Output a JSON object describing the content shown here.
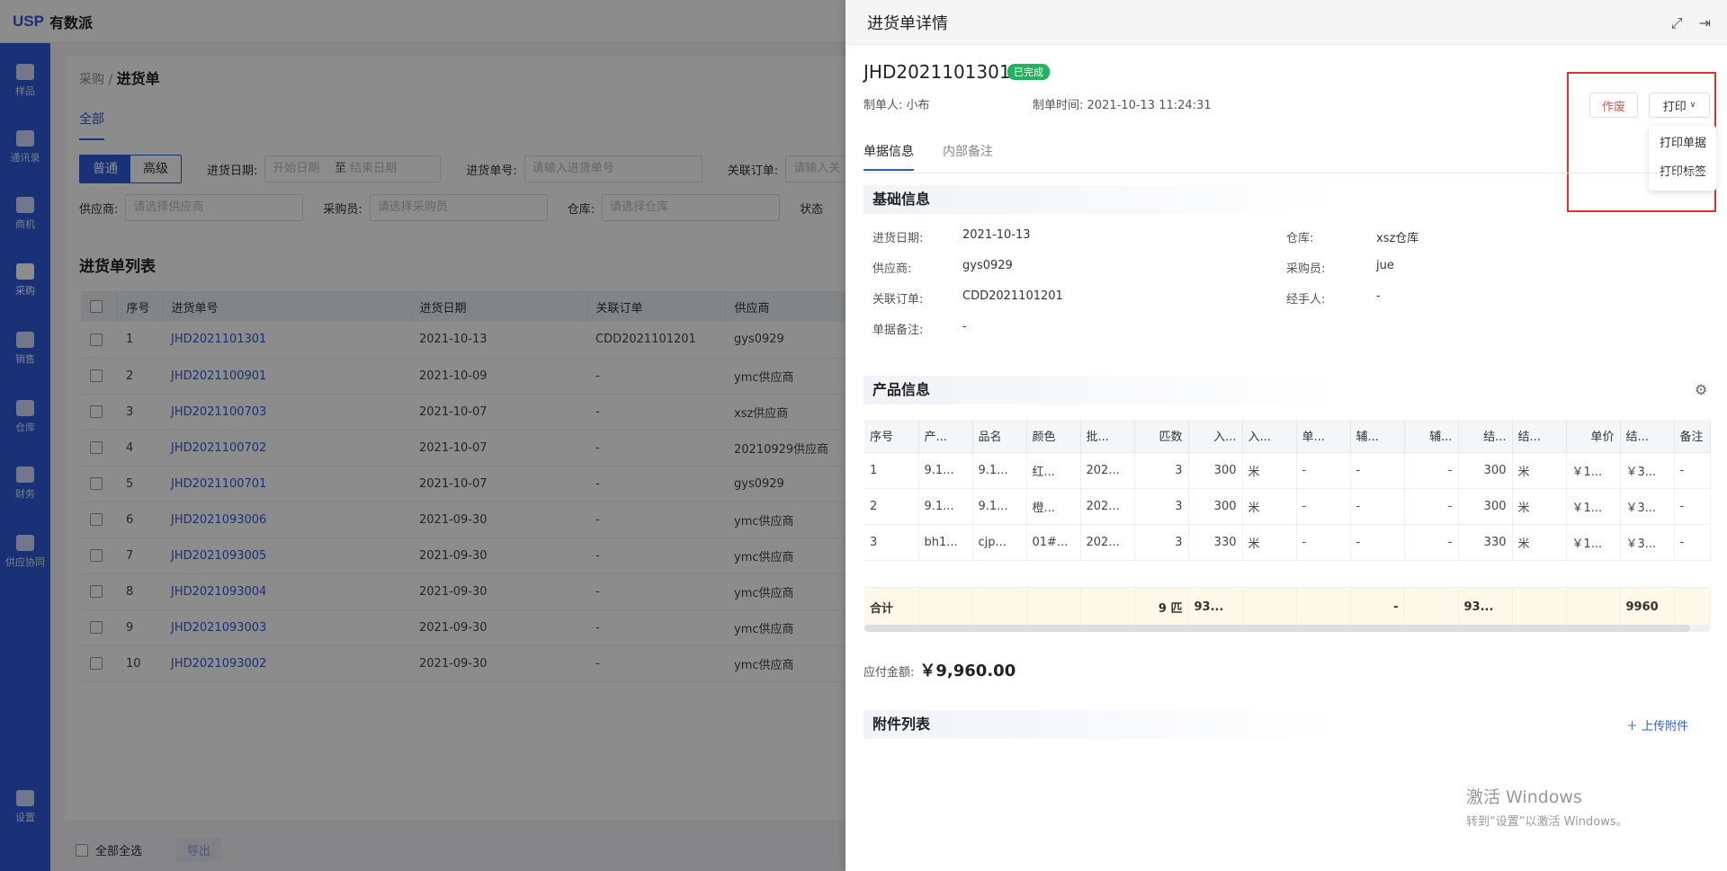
{
  "app": {
    "logo_mark": "USP",
    "logo_text": "有数派"
  },
  "sidebar": {
    "items": [
      {
        "label": "样品"
      },
      {
        "label": "通讯录"
      },
      {
        "label": "商机"
      },
      {
        "label": "采购",
        "active": true
      },
      {
        "label": "销售"
      },
      {
        "label": "仓库"
      },
      {
        "label": "财务"
      },
      {
        "label": "供应协同"
      },
      {
        "label": "设置"
      }
    ]
  },
  "page": {
    "breadcrumb_parent": "采购",
    "breadcrumb_sep": "/",
    "breadcrumb_current": "进货单",
    "tab_all": "全部",
    "filter": {
      "mode_normal": "普通",
      "mode_advanced": "高级",
      "date_label": "进货日期:",
      "date_start": "开始日期",
      "date_to": "至",
      "date_end": "结束日期",
      "no_label": "进货单号:",
      "no_placeholder": "请输入进货单号",
      "order_label": "关联订单:",
      "order_placeholder": "请输入关",
      "supplier_label": "供应商:",
      "supplier_placeholder": "请选择供应商",
      "buyer_label": "采购员:",
      "buyer_placeholder": "请选择采购员",
      "warehouse_label": "仓库:",
      "warehouse_placeholder": "请选择仓库",
      "status_label": "状态"
    },
    "list_title": "进货单列表",
    "columns": [
      "序号",
      "进货单号",
      "进货日期",
      "关联订单",
      "供应商"
    ],
    "rows": [
      [
        "1",
        "JHD2021101301",
        "2021-10-13",
        "CDD2021101201",
        "gys0929"
      ],
      [
        "2",
        "JHD2021100901",
        "2021-10-09",
        "-",
        "ymc供应商"
      ],
      [
        "3",
        "JHD2021100703",
        "2021-10-07",
        "-",
        "xsz供应商"
      ],
      [
        "4",
        "JHD2021100702",
        "2021-10-07",
        "-",
        "20210929供应商"
      ],
      [
        "5",
        "JHD2021100701",
        "2021-10-07",
        "-",
        "gys0929"
      ],
      [
        "6",
        "JHD2021093006",
        "2021-09-30",
        "-",
        "ymc供应商"
      ],
      [
        "7",
        "JHD2021093005",
        "2021-09-30",
        "-",
        "ymc供应商"
      ],
      [
        "8",
        "JHD2021093004",
        "2021-09-30",
        "-",
        "ymc供应商"
      ],
      [
        "9",
        "JHD2021093003",
        "2021-09-30",
        "-",
        "ymc供应商"
      ],
      [
        "10",
        "JHD2021093002",
        "2021-09-30",
        "-",
        "ymc供应商"
      ]
    ],
    "select_all": "全部全选",
    "export": "导出"
  },
  "drawer": {
    "title": "进货单详情",
    "doc_no": "JHD2021101301",
    "status": "已完成",
    "creator_label": "制单人:",
    "creator": "小布",
    "time_label": "制单时间:",
    "time": "2021-10-13 11:24:31",
    "void_label": "作废",
    "print_label": "打印",
    "print_menu": [
      "打印单据",
      "打印标签"
    ],
    "tabs": [
      "单据信息",
      "内部备注"
    ],
    "basic_title": "基础信息",
    "basic": [
      {
        "label": "进货日期:",
        "value": "2021-10-13"
      },
      {
        "label": "供应商:",
        "value": "gys0929"
      },
      {
        "label": "关联订单:",
        "value": "CDD2021101201"
      },
      {
        "label": "单据备注:",
        "value": "-"
      },
      {
        "label": "仓库:",
        "value": "xsz仓库"
      },
      {
        "label": "采购员:",
        "value": "jue"
      },
      {
        "label": "经手人:",
        "value": "-"
      }
    ],
    "product_title": "产品信息",
    "product_columns": [
      "序号",
      "产...",
      "品名",
      "颜色",
      "批...",
      "匹数",
      "入...",
      "入...",
      "单...",
      "辅...",
      "辅...",
      "结...",
      "结...",
      "单价",
      "结...",
      "备注"
    ],
    "product_rows": [
      [
        "1",
        "9.1...",
        "9.1...",
        "红...",
        "202...",
        "3",
        "300",
        "米",
        "-",
        "-",
        "-",
        "300",
        "米",
        "￥1...",
        "￥3...",
        "-"
      ],
      [
        "2",
        "9.1...",
        "9.1...",
        "橙...",
        "202...",
        "3",
        "300",
        "米",
        "-",
        "-",
        "-",
        "300",
        "米",
        "￥1...",
        "￥3...",
        "-"
      ],
      [
        "3",
        "bh1...",
        "cjp...",
        "01#...",
        "202...",
        "3",
        "330",
        "米",
        "-",
        "-",
        "-",
        "330",
        "米",
        "￥1...",
        "￥3...",
        "-"
      ]
    ],
    "total_row": [
      "合计",
      "",
      "",
      "",
      "",
      "9 匹",
      "93...",
      "",
      "",
      "-",
      "",
      "93...",
      "",
      "",
      "9960",
      ""
    ],
    "pay_label": "应付金额:",
    "pay_value": "￥9,960.00",
    "attach_title": "附件列表",
    "upload_label": "上传附件"
  },
  "watermark": {
    "line1": "激活 Windows",
    "line2": "转到“设置”以激活 Windows。"
  },
  "colors": {
    "primary": "#2f5bd9",
    "success": "#22b35e",
    "danger": "#e8523d",
    "highlight_box": "#d9342b"
  }
}
